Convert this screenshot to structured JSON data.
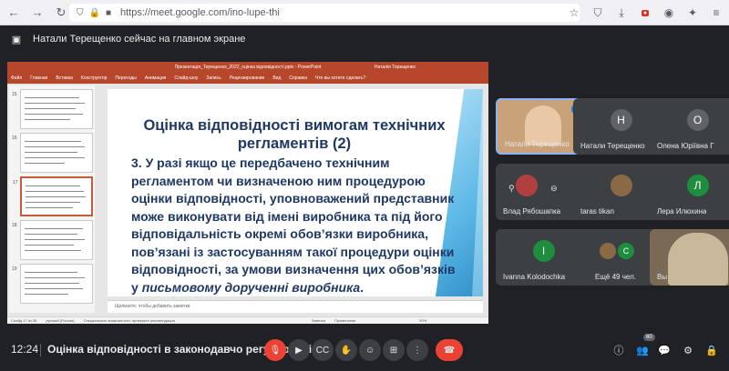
{
  "browser": {
    "url": "https://meet.google.com/ino-lupe-thi"
  },
  "banner": {
    "text": "Натали Терещенко сейчас на главном экране"
  },
  "powerpoint": {
    "window_title": "Презентація_Терещенко_2022_оцінка відповідності.pptx - PowerPoint",
    "user": "Наталія Терещенко",
    "tabs": [
      "Файл",
      "Главная",
      "Вставка",
      "Конструктор",
      "Переходы",
      "Анимация",
      "Слайд-шоу",
      "Запись",
      "Рецензирование",
      "Вид",
      "Справка",
      "Что вы хотите сделать?"
    ],
    "notes_placeholder": "Щелкните, чтобы добавить заметки",
    "status": [
      "Слайд 17 из 36",
      "русский (Россия)",
      "Специальные возможности: проверьте рекомендации",
      "Заметки",
      "Примечания",
      "50%"
    ],
    "thumb_numbers": [
      "15",
      "16",
      "17",
      "18",
      "19"
    ]
  },
  "slide": {
    "title": "Оцінка відповідності вимогам технічних регламентів (2)",
    "body": "3. У разі якщо це передбачено технічним регламентом чи визначеною ним процедурою оцінки відповідності, уповноважений представник може виконувати від імені виробника та під його відповідальність окремі обов’язки виробника, пов’язані із застосуванням такої процедури оцінки відповідності, за умови визначення цих обов’язків у",
    "body_emphasis": "письмовому дорученні виробника",
    "body_end": "."
  },
  "participants": [
    {
      "name": "Натали Терещенко",
      "type": "video",
      "color": "#c9a27a"
    },
    {
      "name": "Натали Терещенко",
      "type": "avatar",
      "initial": "Н",
      "color": "#5f6368"
    },
    {
      "name": "Олена Юріївна Г",
      "type": "avatar",
      "initial": "О",
      "color": "#5f6368"
    },
    {
      "name": "Влад Рябошапка",
      "type": "avatar-img",
      "color": "#b04040"
    },
    {
      "name": "taras tikan",
      "type": "avatar-img",
      "color": "#8a6a45"
    },
    {
      "name": "Лера Илюхина",
      "type": "avatar",
      "initial": "Л",
      "color": "#1e8e3e"
    },
    {
      "name": "Ivanna Kolodochka",
      "type": "avatar",
      "initial": "I",
      "color": "#1e8e3e"
    },
    {
      "name": "Ещё 49 чел.",
      "type": "more",
      "initial": "С",
      "color": "#1e8e3e"
    },
    {
      "name": "Вы",
      "type": "video",
      "color": "#7a6a55"
    }
  ],
  "bottom": {
    "time": "12:24",
    "meeting_title": "Оцінка відповідності в законодавчо регульованій...",
    "participant_count": "60"
  },
  "colors": {
    "meet_bg": "#202124",
    "tile_bg": "#3c4043",
    "red": "#ea4335",
    "slide_text": "#1f3864"
  }
}
